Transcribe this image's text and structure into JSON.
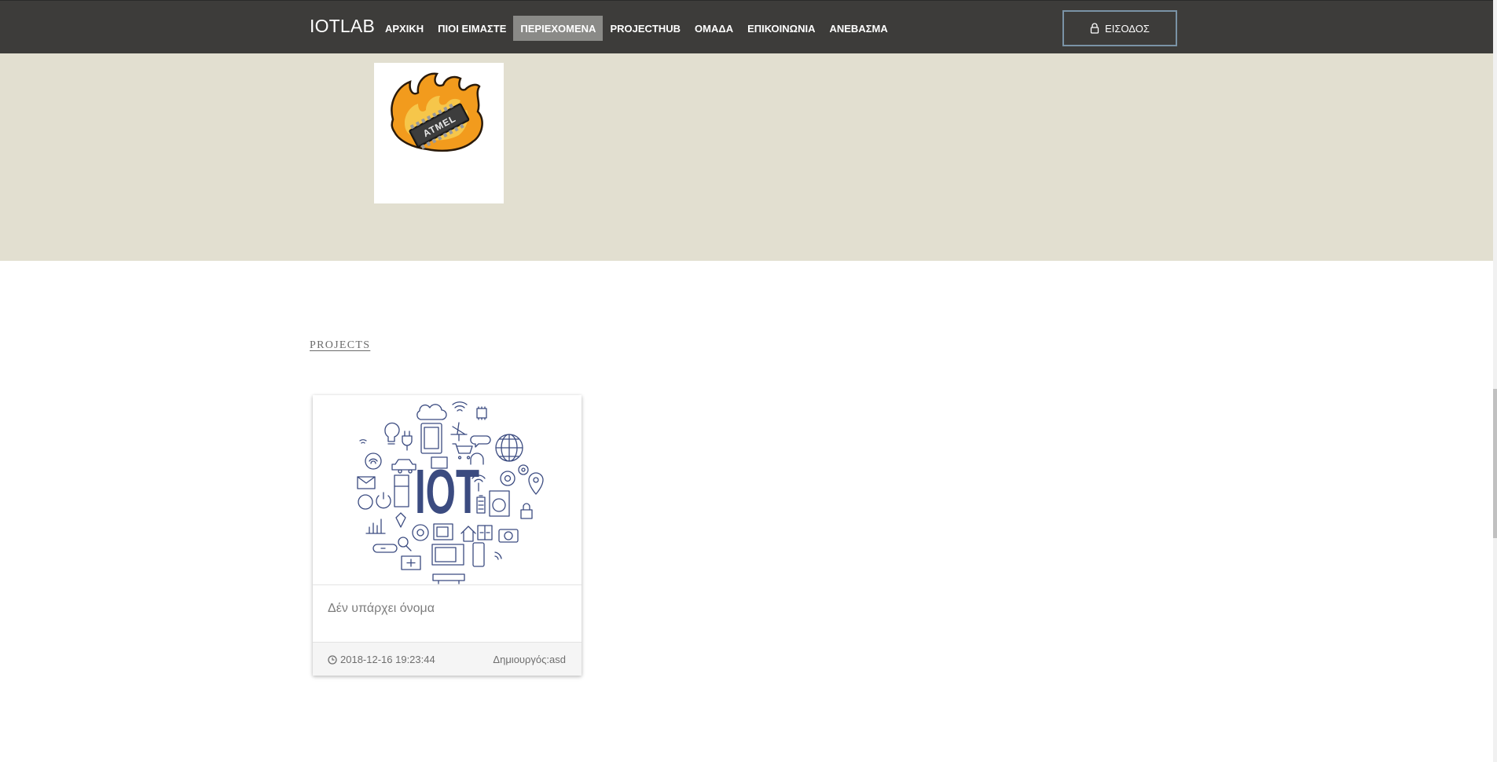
{
  "navbar": {
    "brand": "IOTLAB",
    "items": [
      {
        "label": "ΑΡΧΙΚΗ",
        "active": false
      },
      {
        "label": "ΠΙΟΙ ΕΙΜΑΣΤΕ",
        "active": false
      },
      {
        "label": "ΠΕΡΙΕΧΟΜΕΝΑ",
        "active": true
      },
      {
        "label": "PROJECTHUB",
        "active": false
      },
      {
        "label": "ΟΜΑΔΑ",
        "active": false
      },
      {
        "label": "ΕΠΙΚΟΙΝΩΝΙΑ",
        "active": false
      },
      {
        "label": "ΑΝΕΒΑΣΜΑ",
        "active": false
      }
    ],
    "login": {
      "label": "ΕΙΣΟΔΟΣ",
      "icon": "lock-icon"
    }
  },
  "hero": {
    "logo_text": "ATMEL",
    "logo_icon": "burning-chip-logo"
  },
  "projects": {
    "section_title": "PROJECTS",
    "cards": [
      {
        "image_text": "IOT",
        "image_icon": "iot-icons-illustration",
        "title": "Δέν υπάρχει όνομα",
        "date": "2018-12-16 19:23:44",
        "date_icon": "clock-icon",
        "creator": "Δημιουργός:asd"
      }
    ]
  },
  "colors": {
    "navbar_bg": "#3d3c3a",
    "nav_active_bg": "#8a8a87",
    "hero_bg": "#e2dfd0",
    "login_border": "#7a93a6",
    "iot_blue": "#3b4b80"
  }
}
